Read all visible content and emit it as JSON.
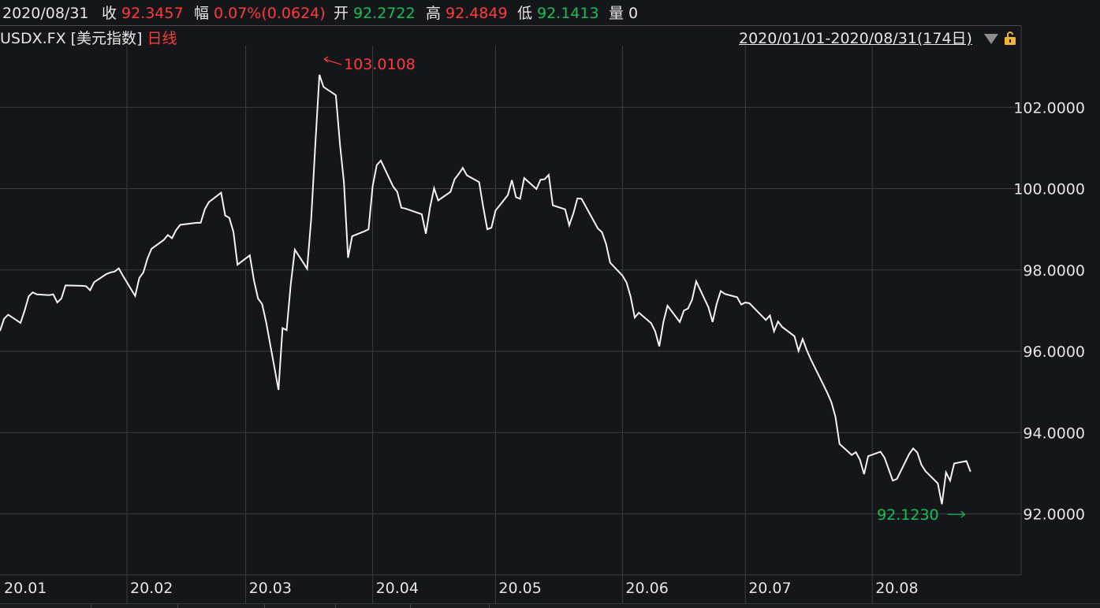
{
  "header": {
    "date": "2020/08/31",
    "close_label": "收",
    "close_value": "92.3457",
    "change_label": "幅",
    "change_value": "0.07%(0.0624)",
    "open_label": "开",
    "open_value": "92.2722",
    "high_label": "高",
    "high_value": "92.4849",
    "low_label": "低",
    "low_value": "92.1413",
    "volume_label": "量",
    "volume_value": "0"
  },
  "subheader": {
    "symbol": "USDX.FX [美元指数]",
    "period": "日线",
    "range": "2020/01/01-2020/08/31(174日)"
  },
  "icons": {
    "dropdown": "triangle-down-icon",
    "lock": "lock-icon"
  },
  "colors": {
    "background": "#151619",
    "grid": "#3a3d43",
    "line": "#f3f3f3",
    "up": "#ff3b3b",
    "down": "#11c15a",
    "lock": "#f3b531"
  },
  "chart_data": {
    "type": "line",
    "x": [
      "2020-01-01",
      "2020-01-02",
      "2020-01-03",
      "2020-01-06",
      "2020-01-07",
      "2020-01-08",
      "2020-01-09",
      "2020-01-10",
      "2020-01-13",
      "2020-01-14",
      "2020-01-15",
      "2020-01-16",
      "2020-01-17",
      "2020-01-21",
      "2020-01-22",
      "2020-01-23",
      "2020-01-24",
      "2020-01-27",
      "2020-01-28",
      "2020-01-29",
      "2020-01-30",
      "2020-01-31",
      "2020-02-03",
      "2020-02-04",
      "2020-02-05",
      "2020-02-06",
      "2020-02-07",
      "2020-02-10",
      "2020-02-11",
      "2020-02-12",
      "2020-02-13",
      "2020-02-14",
      "2020-02-18",
      "2020-02-19",
      "2020-02-20",
      "2020-02-21",
      "2020-02-24",
      "2020-02-25",
      "2020-02-26",
      "2020-02-27",
      "2020-02-28",
      "2020-03-02",
      "2020-03-03",
      "2020-03-04",
      "2020-03-05",
      "2020-03-06",
      "2020-03-09",
      "2020-03-10",
      "2020-03-11",
      "2020-03-12",
      "2020-03-13",
      "2020-03-16",
      "2020-03-17",
      "2020-03-18",
      "2020-03-19",
      "2020-03-20",
      "2020-03-23",
      "2020-03-24",
      "2020-03-25",
      "2020-03-26",
      "2020-03-27",
      "2020-03-30",
      "2020-03-31",
      "2020-04-01",
      "2020-04-02",
      "2020-04-03",
      "2020-04-06",
      "2020-04-07",
      "2020-04-08",
      "2020-04-09",
      "2020-04-13",
      "2020-04-14",
      "2020-04-15",
      "2020-04-16",
      "2020-04-17",
      "2020-04-20",
      "2020-04-21",
      "2020-04-22",
      "2020-04-23",
      "2020-04-24",
      "2020-04-27",
      "2020-04-28",
      "2020-04-29",
      "2020-04-30",
      "2020-05-01",
      "2020-05-04",
      "2020-05-05",
      "2020-05-06",
      "2020-05-07",
      "2020-05-08",
      "2020-05-11",
      "2020-05-12",
      "2020-05-13",
      "2020-05-14",
      "2020-05-15",
      "2020-05-18",
      "2020-05-19",
      "2020-05-20",
      "2020-05-21",
      "2020-05-22",
      "2020-05-26",
      "2020-05-27",
      "2020-05-28",
      "2020-05-29",
      "2020-06-01",
      "2020-06-02",
      "2020-06-03",
      "2020-06-04",
      "2020-06-05",
      "2020-06-08",
      "2020-06-09",
      "2020-06-10",
      "2020-06-11",
      "2020-06-12",
      "2020-06-15",
      "2020-06-16",
      "2020-06-17",
      "2020-06-18",
      "2020-06-19",
      "2020-06-22",
      "2020-06-23",
      "2020-06-24",
      "2020-06-25",
      "2020-06-26",
      "2020-06-29",
      "2020-06-30",
      "2020-07-01",
      "2020-07-02",
      "2020-07-06",
      "2020-07-07",
      "2020-07-08",
      "2020-07-09",
      "2020-07-10",
      "2020-07-13",
      "2020-07-14",
      "2020-07-15",
      "2020-07-16",
      "2020-07-17",
      "2020-07-20",
      "2020-07-21",
      "2020-07-22",
      "2020-07-23",
      "2020-07-24",
      "2020-07-27",
      "2020-07-28",
      "2020-07-29",
      "2020-07-30",
      "2020-07-31",
      "2020-08-03",
      "2020-08-04",
      "2020-08-05",
      "2020-08-06",
      "2020-08-07",
      "2020-08-10",
      "2020-08-11",
      "2020-08-12",
      "2020-08-13",
      "2020-08-14",
      "2020-08-17",
      "2020-08-18",
      "2020-08-19",
      "2020-08-20",
      "2020-08-21",
      "2020-08-24",
      "2020-08-25",
      "2020-08-26",
      "2020-08-27",
      "2020-08-28",
      "2020-08-31"
    ],
    "values": [
      96.5,
      96.8,
      96.9,
      96.7,
      97.0,
      97.35,
      97.45,
      97.4,
      97.38,
      97.4,
      97.2,
      97.3,
      97.62,
      97.61,
      97.6,
      97.5,
      97.7,
      97.9,
      97.94,
      97.96,
      98.04,
      97.86,
      97.36,
      97.8,
      97.94,
      98.28,
      98.52,
      98.74,
      98.86,
      98.78,
      98.98,
      99.11,
      99.16,
      99.16,
      99.49,
      99.67,
      99.9,
      99.34,
      99.28,
      98.94,
      98.13,
      98.36,
      97.75,
      97.3,
      97.16,
      96.71,
      95.05,
      96.57,
      96.52,
      97.64,
      98.5,
      98.03,
      99.27,
      101.09,
      102.8,
      102.5,
      102.3,
      101.1,
      100.15,
      98.3,
      98.83,
      98.95,
      99.0,
      100.06,
      100.58,
      100.69,
      100.05,
      99.92,
      99.53,
      99.51,
      99.37,
      98.89,
      99.53,
      100.01,
      99.71,
      99.92,
      100.23,
      100.36,
      100.51,
      100.33,
      100.16,
      99.55,
      99.0,
      99.04,
      99.46,
      99.84,
      100.21,
      99.79,
      99.75,
      100.26,
      99.99,
      100.22,
      100.23,
      100.34,
      99.59,
      99.49,
      99.1,
      99.39,
      99.76,
      99.75,
      99.02,
      98.93,
      98.64,
      98.18,
      97.86,
      97.69,
      97.34,
      96.83,
      96.95,
      96.69,
      96.49,
      96.12,
      96.72,
      97.12,
      96.72,
      97.0,
      97.05,
      97.27,
      97.72,
      97.08,
      96.72,
      97.16,
      97.48,
      97.41,
      97.33,
      97.15,
      97.2,
      97.18,
      96.77,
      96.88,
      96.49,
      96.73,
      96.6,
      96.37,
      96.01,
      96.3,
      96.03,
      95.8,
      95.19,
      94.98,
      94.75,
      94.39,
      93.72,
      93.45,
      93.52,
      93.33,
      92.98,
      93.42,
      93.53,
      93.38,
      93.1,
      92.82,
      92.86,
      93.47,
      93.61,
      93.51,
      93.21,
      93.05,
      92.75,
      92.24,
      93.02,
      92.82,
      93.24,
      93.3,
      93.04
    ],
    "ylim": [
      90.5,
      104.0
    ],
    "yticks": [
      "92.0000",
      "94.0000",
      "96.0000",
      "98.0000",
      "100.0000",
      "102.0000"
    ],
    "xticks": [
      "20.01",
      "20.02",
      "20.03",
      "20.04",
      "20.05",
      "20.06",
      "20.07",
      "20.08"
    ],
    "annotations": [
      {
        "label": "103.0108",
        "at": "2020-03-19",
        "value": 103.0108,
        "color": "#ff3b3b"
      },
      {
        "label": "92.1230",
        "at": "2020-08-24",
        "value": 92.123,
        "color": "#11c15a"
      }
    ],
    "grid": true,
    "legend": "none"
  }
}
